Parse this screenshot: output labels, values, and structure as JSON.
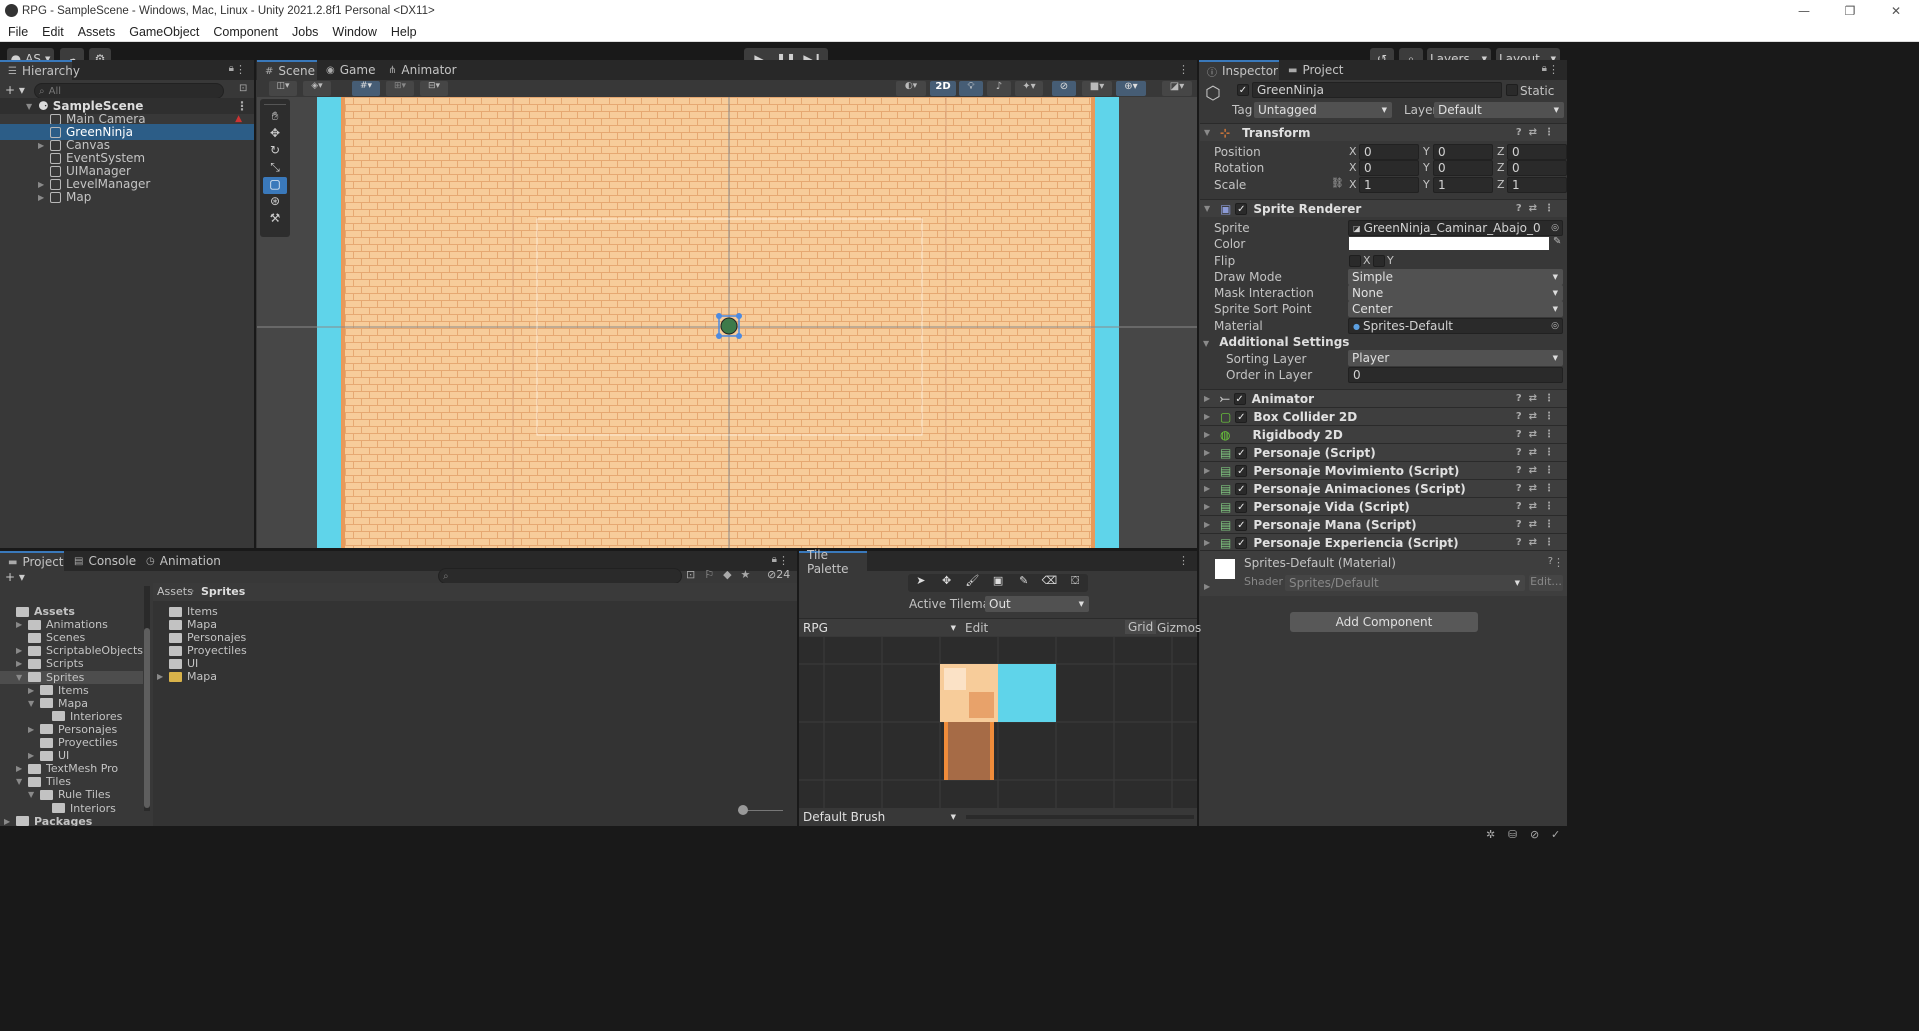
{
  "window": {
    "title": "RPG - SampleScene - Windows, Mac, Linux - Unity 2021.2.8f1 Personal <DX11>"
  },
  "menu": [
    "File",
    "Edit",
    "Assets",
    "GameObject",
    "Component",
    "Jobs",
    "Window",
    "Help"
  ],
  "toolbar": {
    "account": "AS",
    "layers": "Layers",
    "layout": "Layout"
  },
  "hierarchy": {
    "tab": "Hierarchy",
    "search_placeholder": "All",
    "scene": "SampleScene",
    "items": [
      {
        "label": "Main Camera",
        "expandable": false,
        "selected": false
      },
      {
        "label": "GreenNinja",
        "expandable": false,
        "selected": true
      },
      {
        "label": "Canvas",
        "expandable": true,
        "selected": false
      },
      {
        "label": "EventSystem",
        "expandable": false,
        "selected": false
      },
      {
        "label": "UIManager",
        "expandable": false,
        "selected": false
      },
      {
        "label": "LevelManager",
        "expandable": true,
        "selected": false
      },
      {
        "label": "Map",
        "expandable": true,
        "selected": false
      }
    ]
  },
  "scene_tabs": [
    "Scene",
    "Game",
    "Animator"
  ],
  "scene_toolbar": {
    "mode_2d": "2D"
  },
  "inspector": {
    "tabs": [
      "Inspector",
      "Project"
    ],
    "object_name": "GreenNinja",
    "static_label": "Static",
    "tag_label": "Tag",
    "tag_value": "Untagged",
    "layer_label": "Layer",
    "layer_value": "Default",
    "transform": {
      "title": "Transform",
      "position_label": "Position",
      "rotation_label": "Rotation",
      "scale_label": "Scale",
      "position": [
        "0",
        "0",
        "0"
      ],
      "rotation": [
        "0",
        "0",
        "0"
      ],
      "scale": [
        "1",
        "1",
        "1"
      ],
      "axis": [
        "X",
        "Y",
        "Z"
      ]
    },
    "sprite_renderer": {
      "title": "Sprite Renderer",
      "sprite_label": "Sprite",
      "sprite_value": "GreenNinja_Caminar_Abajo_0",
      "color_label": "Color",
      "flip_label": "Flip",
      "flip_x": "X",
      "flip_y": "Y",
      "draw_mode_label": "Draw Mode",
      "draw_mode_value": "Simple",
      "mask_label": "Mask Interaction",
      "mask_value": "None",
      "sort_point_label": "Sprite Sort Point",
      "sort_point_value": "Center",
      "material_label": "Material",
      "material_value": "Sprites-Default",
      "additional_label": "Additional Settings",
      "sorting_layer_label": "Sorting Layer",
      "sorting_layer_value": "Player",
      "order_label": "Order in Layer",
      "order_value": "0"
    },
    "components": [
      {
        "label": "Animator",
        "checkbox": true
      },
      {
        "label": "Box Collider 2D",
        "checkbox": true
      },
      {
        "label": "Rigidbody 2D",
        "checkbox": false
      },
      {
        "label": "Personaje (Script)",
        "checkbox": true
      },
      {
        "label": "Personaje Movimiento (Script)",
        "checkbox": true
      },
      {
        "label": "Personaje Animaciones (Script)",
        "checkbox": true
      },
      {
        "label": "Personaje Vida (Script)",
        "checkbox": true
      },
      {
        "label": "Personaje Mana (Script)",
        "checkbox": true
      },
      {
        "label": "Personaje Experiencia (Script)",
        "checkbox": true
      }
    ],
    "material_block": {
      "name": "Sprites-Default (Material)",
      "shader_label": "Shader",
      "shader_value": "Sprites/Default",
      "edit_label": "Edit..."
    },
    "add_component": "Add Component"
  },
  "project": {
    "tabs": [
      "Project",
      "Console",
      "Animation"
    ],
    "hidden_count": "24",
    "breadcrumb": [
      "Assets",
      "Sprites"
    ],
    "tree": [
      {
        "label": "Assets",
        "indent": 0,
        "open": true,
        "bold": true
      },
      {
        "label": "Animations",
        "indent": 1,
        "open": false,
        "arrow": true
      },
      {
        "label": "Scenes",
        "indent": 1,
        "arrow": false
      },
      {
        "label": "ScriptableObjects",
        "indent": 1,
        "arrow": true
      },
      {
        "label": "Scripts",
        "indent": 1,
        "arrow": true
      },
      {
        "label": "Sprites",
        "indent": 1,
        "open": true,
        "arrow": true,
        "selected": true
      },
      {
        "label": "Items",
        "indent": 2,
        "arrow": true
      },
      {
        "label": "Mapa",
        "indent": 2,
        "open": true,
        "arrow": true
      },
      {
        "label": "Interiores",
        "indent": 3,
        "arrow": false
      },
      {
        "label": "Personajes",
        "indent": 2,
        "arrow": true
      },
      {
        "label": "Proyectiles",
        "indent": 2,
        "arrow": false
      },
      {
        "label": "UI",
        "indent": 2,
        "arrow": true
      },
      {
        "label": "TextMesh Pro",
        "indent": 1,
        "arrow": true
      },
      {
        "label": "Tiles",
        "indent": 1,
        "open": true,
        "arrow": true
      },
      {
        "label": "Rule Tiles",
        "indent": 2,
        "open": true,
        "arrow": true
      },
      {
        "label": "Interiors",
        "indent": 3,
        "arrow": false
      },
      {
        "label": "Packages",
        "indent": 0,
        "arrow": true,
        "bold": true
      }
    ],
    "files": [
      {
        "label": "Items",
        "arrow": false
      },
      {
        "label": "Mapa",
        "arrow": false
      },
      {
        "label": "Personajes",
        "arrow": false
      },
      {
        "label": "Proyectiles",
        "arrow": false
      },
      {
        "label": "UI",
        "arrow": false
      },
      {
        "label": "Mapa",
        "arrow": true,
        "yellow": true
      }
    ]
  },
  "tile_palette": {
    "tab": "Tile Palette",
    "active_tilemap_label": "Active Tilemap",
    "active_tilemap_value": "Out",
    "palette": "RPG",
    "edit": "Edit",
    "grid": "Grid",
    "gizmos": "Gizmos",
    "brush": "Default Brush"
  },
  "colors": {
    "accent": "#3a79bb",
    "selection": "#2c5d87",
    "brick": "#f6c896",
    "water": "#5fd4ea"
  }
}
